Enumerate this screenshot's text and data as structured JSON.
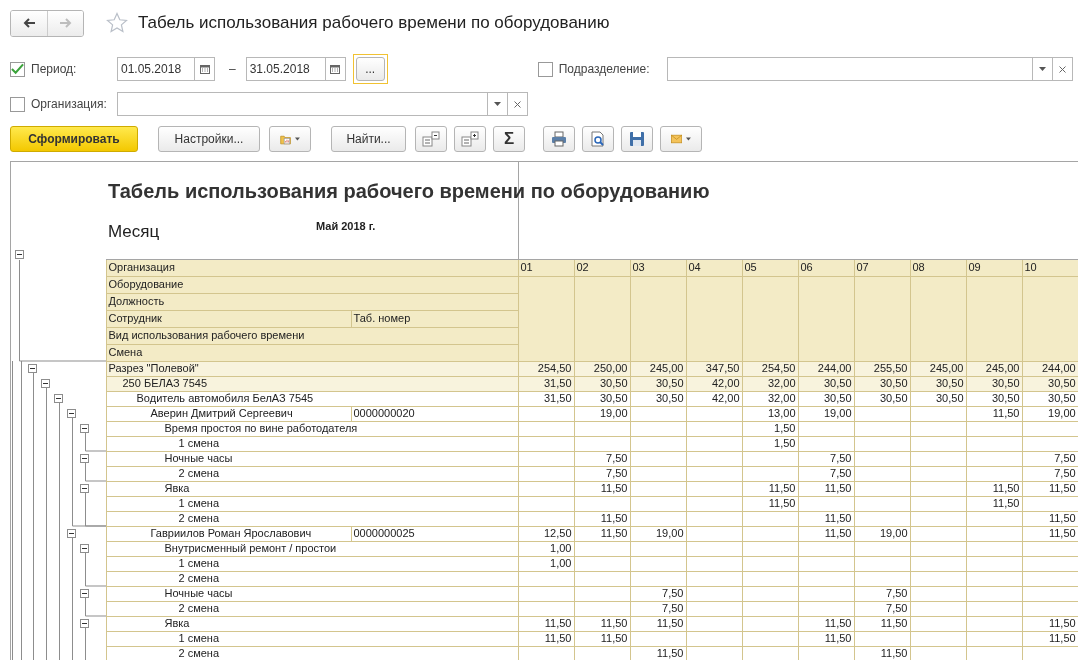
{
  "header": {
    "back": {
      "disabled": false
    },
    "forward": {
      "disabled": true
    },
    "title": "Табель использования рабочего времени по оборудованию"
  },
  "filters": {
    "period": {
      "label": "Период:",
      "checked": true,
      "from": "01.05.2018",
      "separator": "–",
      "to": "31.05.2018",
      "more": "..."
    },
    "department": {
      "label": "Подразделение:",
      "checked": false
    },
    "organization": {
      "label": "Организация:",
      "checked": false
    }
  },
  "toolbar": {
    "generate": "Сформировать",
    "settings": "Настройки...",
    "find": "Найти...",
    "sum": "Σ"
  },
  "report": {
    "title": "Табель использования рабочего времени по оборудованию",
    "month_label": "Месяц",
    "month_value": "Май 2018 г.",
    "header_expanded": true,
    "column_headers": [
      {
        "label": "Организация"
      },
      {
        "label": "Оборудование"
      },
      {
        "label": "Должность"
      },
      {
        "label": "Сотрудник",
        "tab_number_label": "Таб. номер"
      },
      {
        "label": "Вид использования рабочего времени"
      },
      {
        "label": "Смена"
      }
    ],
    "days": [
      "01",
      "02",
      "03",
      "04",
      "05",
      "06",
      "07",
      "08",
      "09",
      "10"
    ],
    "rows": [
      {
        "kind": "section",
        "label": "Разрез \"Полевой\"",
        "expanded": true,
        "values": {
          "day_1": "254,50",
          "day_2": "250,00",
          "day_3": "245,00",
          "day_4": "347,50",
          "day_5": "254,50",
          "day_6": "244,00",
          "day_7": "255,50",
          "day_8": "245,00",
          "day_9": "245,00",
          "day_10": "244,00"
        },
        "children": [
          {
            "kind": "equipment",
            "label": "250 БЕЛАЗ 7545",
            "expanded": true,
            "values": {
              "day_1": "31,50",
              "day_2": "30,50",
              "day_3": "30,50",
              "day_4": "42,00",
              "day_5": "32,00",
              "day_6": "30,50",
              "day_7": "30,50",
              "day_8": "30,50",
              "day_9": "30,50",
              "day_10": "30,50"
            },
            "children": [
              {
                "kind": "position",
                "label": "Водитель автомобиля БелАЗ 7545",
                "expanded": true,
                "values": {
                  "day_1": "31,50",
                  "day_2": "30,50",
                  "day_3": "30,50",
                  "day_4": "42,00",
                  "day_5": "32,00",
                  "day_6": "30,50",
                  "day_7": "30,50",
                  "day_8": "30,50",
                  "day_9": "30,50",
                  "day_10": "30,50"
                },
                "children": [
                  {
                    "kind": "employee",
                    "label": "Аверин Дмитрий Сергеевич",
                    "tab_number": "0000000020",
                    "expanded": true,
                    "values": {
                      "day_2": "19,00",
                      "day_5": "13,00",
                      "day_6": "19,00",
                      "day_9": "11,50",
                      "day_10": "19,00"
                    },
                    "children": [
                      {
                        "kind": "work_type",
                        "label": "Время простоя по вине работодателя",
                        "expanded": true,
                        "values": {
                          "day_5": "1,50"
                        },
                        "children": [
                          {
                            "kind": "shift",
                            "label": "1 смена",
                            "values": {
                              "day_5": "1,50"
                            }
                          }
                        ]
                      },
                      {
                        "kind": "work_type",
                        "label": "Ночные часы",
                        "expanded": true,
                        "values": {
                          "day_2": "7,50",
                          "day_6": "7,50",
                          "day_10": "7,50"
                        },
                        "children": [
                          {
                            "kind": "shift",
                            "label": "2 смена",
                            "values": {
                              "day_2": "7,50",
                              "day_6": "7,50",
                              "day_10": "7,50"
                            }
                          }
                        ]
                      },
                      {
                        "kind": "work_type",
                        "label": "Явка",
                        "expanded": true,
                        "values": {
                          "day_2": "11,50",
                          "day_5": "11,50",
                          "day_6": "11,50",
                          "day_9": "11,50",
                          "day_10": "11,50"
                        },
                        "children": [
                          {
                            "kind": "shift",
                            "label": "1 смена",
                            "values": {
                              "day_5": "11,50",
                              "day_9": "11,50"
                            }
                          },
                          {
                            "kind": "shift",
                            "label": "2 смена",
                            "values": {
                              "day_2": "11,50",
                              "day_6": "11,50",
                              "day_10": "11,50"
                            }
                          }
                        ]
                      }
                    ]
                  },
                  {
                    "kind": "employee",
                    "label": "Гавриилов Роман Ярославович",
                    "tab_number": "0000000025",
                    "expanded": true,
                    "values": {
                      "day_1": "12,50",
                      "day_2": "11,50",
                      "day_3": "19,00",
                      "day_6": "11,50",
                      "day_7": "19,00",
                      "day_10": "11,50"
                    },
                    "children": [
                      {
                        "kind": "work_type",
                        "label": "Внутрисменный ремонт / простои",
                        "expanded": true,
                        "values": {
                          "day_1": "1,00"
                        },
                        "children": [
                          {
                            "kind": "shift",
                            "label": "1 смена",
                            "values": {
                              "day_1": "1,00"
                            }
                          },
                          {
                            "kind": "shift",
                            "label": "2 смена"
                          }
                        ]
                      },
                      {
                        "kind": "work_type",
                        "label": "Ночные часы",
                        "expanded": true,
                        "values": {
                          "day_3": "7,50",
                          "day_7": "7,50"
                        },
                        "children": [
                          {
                            "kind": "shift",
                            "label": "2 смена",
                            "values": {
                              "day_3": "7,50",
                              "day_7": "7,50"
                            }
                          }
                        ]
                      },
                      {
                        "kind": "work_type",
                        "label": "Явка",
                        "expanded": true,
                        "values": {
                          "day_1": "11,50",
                          "day_2": "11,50",
                          "day_3": "11,50",
                          "day_6": "11,50",
                          "day_7": "11,50",
                          "day_10": "11,50"
                        },
                        "children": [
                          {
                            "kind": "shift",
                            "label": "1 смена",
                            "values": {
                              "day_1": "11,50",
                              "day_2": "11,50",
                              "day_6": "11,50",
                              "day_10": "11,50"
                            }
                          },
                          {
                            "kind": "shift",
                            "label": "2 смена",
                            "values": {
                              "day_3": "11,50",
                              "day_7": "11,50"
                            }
                          }
                        ]
                      }
                    ]
                  }
                ]
              }
            ]
          }
        ]
      }
    ]
  }
}
